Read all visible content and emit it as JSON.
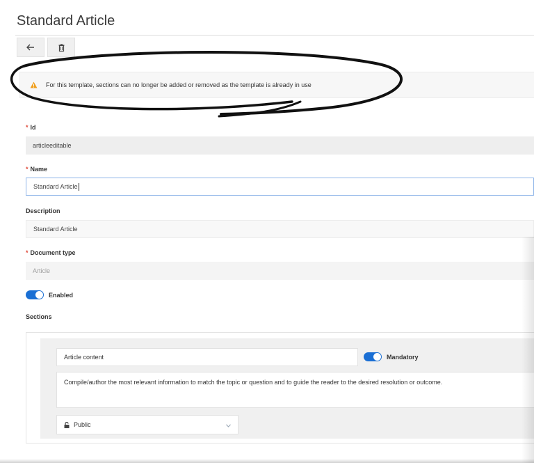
{
  "page": {
    "title": "Standard Article"
  },
  "toolbar": {
    "back_icon": "arrow-left-icon",
    "delete_icon": "trash-icon"
  },
  "warning": {
    "icon": "warning-triangle-icon",
    "color": "#f0a020",
    "text": "For this template, sections can no longer be added or removed as the template is already in use"
  },
  "form": {
    "id": {
      "label": "Id",
      "required": true,
      "value": "articleeditable"
    },
    "name": {
      "label": "Name",
      "required": true,
      "value": "Standard Article"
    },
    "description": {
      "label": "Description",
      "required": false,
      "value": "Standard Article"
    },
    "document_type": {
      "label": "Document type",
      "required": true,
      "value": "Article"
    },
    "enabled": {
      "label": "Enabled",
      "on": true
    }
  },
  "sections": {
    "label": "Sections",
    "items": [
      {
        "name": "Article content",
        "mandatory_label": "Mandatory",
        "mandatory_on": true,
        "description": "Compile/author the most relevant information to match the topic or question and to guide the reader to the desired resolution or outcome.",
        "visibility": "Public",
        "visibility_icon": "lock-icon"
      }
    ]
  },
  "colors": {
    "accent": "#1a6fd4",
    "required": "#e04c3c"
  }
}
